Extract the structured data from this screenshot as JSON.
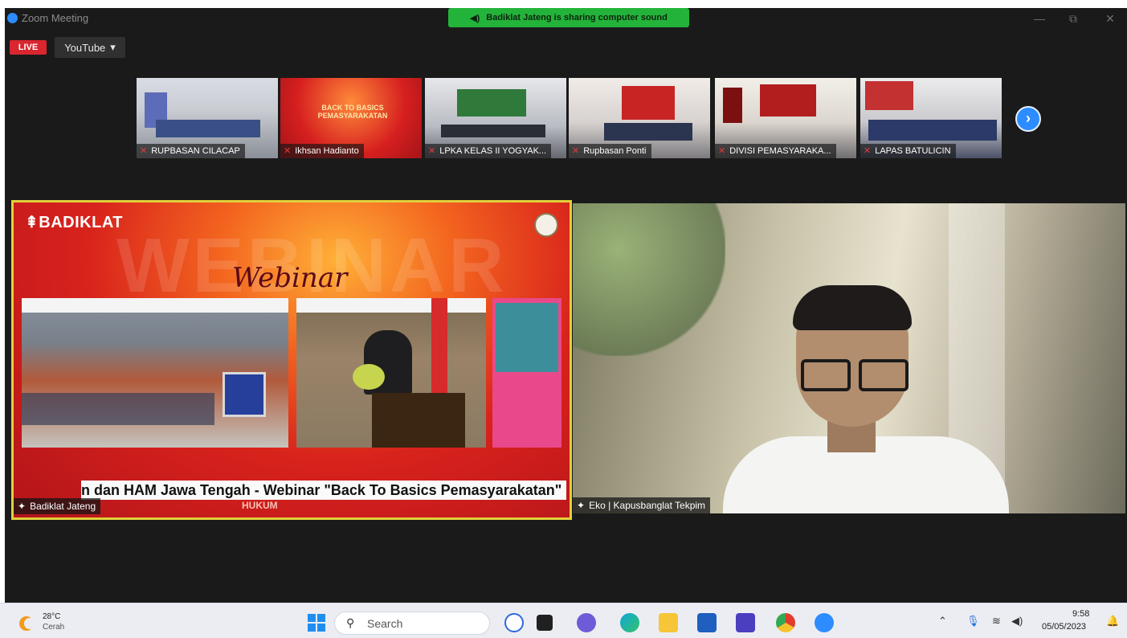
{
  "window": {
    "title": "Zoom Meeting",
    "controls": [
      "—",
      "⧉",
      "✕"
    ]
  },
  "share_banner": {
    "text": "Badiklat Jateng is sharing computer sound"
  },
  "live_badge": "LIVE",
  "stream_menu": {
    "label": "YouTube",
    "arrow": "▾"
  },
  "gallery": {
    "thumbnails": [
      {
        "name": "RUPBASAN CILACAP"
      },
      {
        "name": "Ikhsan Hadianto"
      },
      {
        "name": "LPKA KELAS II YOGYAK..."
      },
      {
        "name": "Rupbasan Ponti"
      },
      {
        "name": "DIVISI PEMASYARAKA..."
      },
      {
        "name": "LAPAS BATULICIN"
      }
    ],
    "next_arrow": "›"
  },
  "share": {
    "brand": "BADIKLAT",
    "webinar_bg": "WEBINAR",
    "webinar_script": "Webinar",
    "ticker": "n dan HAM Jawa Tengah - Webinar \"Back To Basics Pemasyarakatan\"",
    "presenter": "Badiklat Jateng",
    "slide_title_line1": "BACK TO BASICS",
    "slide_title_line2": "PEMASYARAKATAN",
    "footer_logos": "HUKUM"
  },
  "speaker": {
    "name": "Eko | Kapusbanglat Tekpim"
  },
  "taskbar": {
    "weather_temp": "28°C",
    "weather_desc": "Cerah",
    "search_placeholder": "Search",
    "time": "9:58",
    "date": "05/05/2023"
  },
  "colors": {
    "zoom_blue": "#2d8cff",
    "share_green": "#23b33a",
    "live_red": "#d9262f",
    "active_border": "#e1d03c"
  }
}
